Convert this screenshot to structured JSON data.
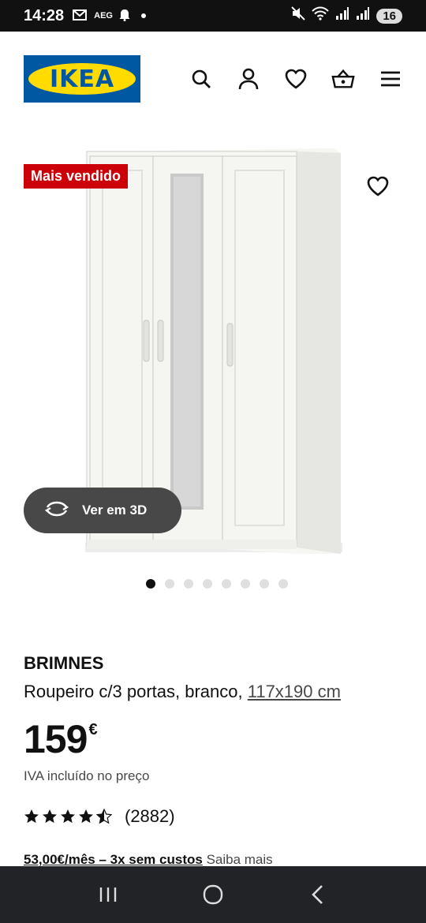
{
  "status_bar": {
    "time": "14:28",
    "notif_icons": "M AEG",
    "battery": "16"
  },
  "header": {
    "logo_text": "IKEA",
    "icons": [
      "search-icon",
      "user-icon",
      "heart-icon",
      "basket-icon",
      "menu-icon"
    ]
  },
  "product_media": {
    "badge": "Mais vendido",
    "view_3d_label": "Ver em 3D",
    "gallery_count": 8,
    "active_index": 0
  },
  "product": {
    "name": "BRIMNES",
    "description": "Roupeiro c/3 portas, branco,",
    "size": "117x190 cm",
    "price": "159",
    "currency": "€",
    "vat_note": "IVA incluído no preço",
    "rating": 4.5,
    "reviews": "(2882)",
    "installment_text": "53,00€/mês – 3x sem custos",
    "installment_link": "Saiba mais"
  },
  "colors": {
    "ikea_blue": "#0058a3",
    "ikea_yellow": "#ffdb00",
    "badge_red": "#cc0008"
  }
}
